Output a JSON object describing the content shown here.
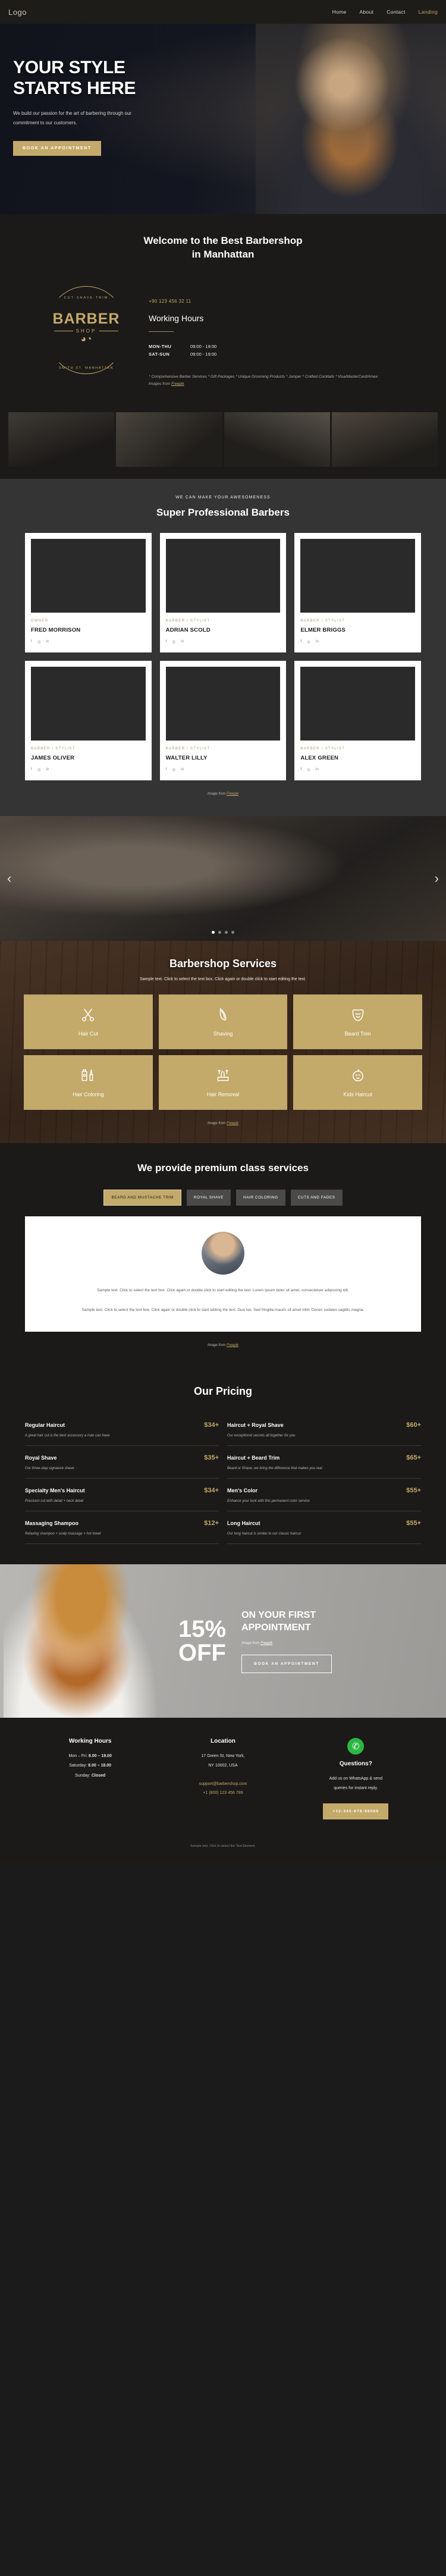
{
  "nav": {
    "logo": "Logo",
    "links": [
      {
        "label": "Home",
        "active": false
      },
      {
        "label": "About",
        "active": false
      },
      {
        "label": "Contact",
        "active": false
      },
      {
        "label": "Landing",
        "active": true
      }
    ]
  },
  "hero": {
    "title_line1": "YOUR STYLE",
    "title_line2": "STARTS HERE",
    "paragraph": "We build our passion for the art of barbering through our commitment to our customers.",
    "cta": "BOOK AN APPOINTMENT"
  },
  "welcome": {
    "heading_line1": "Welcome to the Best Barbershop",
    "heading_line2": "in Manhattan",
    "badge": {
      "arc_top": "CUT·SHAVE·TRIM",
      "word": "BARBER",
      "shop": "SHOP",
      "arc_bottom": "SMITH ST. MANHATTAN"
    },
    "phone": "+90 123 456 32 11",
    "hours_title": "Working Hours",
    "hours": [
      {
        "day": "MON-THU",
        "time": "09:00 - 19:00"
      },
      {
        "day": "SAT-SUN",
        "time": "09:00 - 19:00"
      }
    ],
    "fine_print": "* Comprehensive Barber Services * Gift Packages * Unique Grooming Products * Juniper * Crafted Cocktails *  Visa/MasterCard/Amex. Images from ",
    "fine_print_link": "Freepik"
  },
  "barbers": {
    "eyebrow": "WE CAN MAKE YOUR AWESOMENESS",
    "heading": "Super Professional Barbers",
    "people": [
      {
        "role": "OWNER",
        "name": "FRED MORRISON"
      },
      {
        "role": "BARBER / STYLIST",
        "name": "ADRIAN SCOLD"
      },
      {
        "role": "BARBER / STYLIST",
        "name": "ELMER BRIGGS"
      },
      {
        "role": "BARBER / STYLIST",
        "name": "JAMES OLIVER"
      },
      {
        "role": "BARBER / STYLIST",
        "name": "WALTER LILLY"
      },
      {
        "role": "BARBER / STYLIST",
        "name": "ALEX GREEN"
      }
    ],
    "socials": [
      "f",
      "◎",
      "in"
    ],
    "credit_prefix": "Image from ",
    "credit_link": "Freepik"
  },
  "slider": {
    "prev": "‹",
    "next": "›",
    "dots": 4,
    "active_dot": 0
  },
  "services": {
    "heading": "Barbershop Services",
    "subtitle": "Sample text. Click to select the text box. Click again or double click to start editing the text.",
    "items": [
      {
        "label": "Hair Cut",
        "icon": "scissors-icon"
      },
      {
        "label": "Shaving",
        "icon": "razor-icon"
      },
      {
        "label": "Beard Trim",
        "icon": "beard-icon"
      },
      {
        "label": "Hair Coloring",
        "icon": "hair-color-icon"
      },
      {
        "label": "Hair Removal",
        "icon": "hair-removal-icon"
      },
      {
        "label": "Kids Haircut",
        "icon": "kid-face-icon"
      }
    ],
    "credit_prefix": "Image from ",
    "credit_link": "Freepik"
  },
  "premium": {
    "heading": "We provide premium class services",
    "tabs": [
      {
        "label": "BEARD AND MUSTACHE TRIM",
        "active": true
      },
      {
        "label": "ROYAL SHAVE",
        "active": false
      },
      {
        "label": "HAIR COLORING",
        "active": false
      },
      {
        "label": "CUTS AND FADES",
        "active": false
      }
    ],
    "body_line1": "Sample text. Click to select the text box. Click again or double click to start editing the text. Lorem ipsum dolor sit amet, consectetuer adipiscing elit.",
    "body_line2": "Sample text. Click to select the text box. Click again or double click to start editing the text. Duis leo. Sed fringilla mauris sit amet nibh. Donec sodales sagittis magna.",
    "credit_prefix": "Image from ",
    "credit_link": "Freepik"
  },
  "pricing": {
    "heading": "Our Pricing",
    "items": [
      {
        "name": "Regular Haircut",
        "price": "$34+",
        "desc": "A great hair cut is the best accessory a man can have"
      },
      {
        "name": "Haircut + Royal Shave",
        "price": "$60+",
        "desc": "Our exceptional secrets all together for you"
      },
      {
        "name": "Royal Shave",
        "price": "$35+",
        "desc": "Our three-step signature shave"
      },
      {
        "name": "Haircut + Beard Trim",
        "price": "$65+",
        "desc": "Beard or Shave, we bring the difference that makes you real"
      },
      {
        "name": "Specialty Men's Haircut",
        "price": "$34+",
        "desc": "Precision cut with detail + neck detail"
      },
      {
        "name": "Men's Color",
        "price": "$55+",
        "desc": "Enhance your look with this permanent color service"
      },
      {
        "name": "Massaging Shampoo",
        "price": "$12+",
        "desc": "Relaxing shampoo + scalp massage + hot towel"
      },
      {
        "name": "Long Haircut",
        "price": "$55+",
        "desc": "Our long haircut is similar to our classic haircut"
      }
    ]
  },
  "promo": {
    "percent": "15%",
    "off": "OFF",
    "headline_line1": "ON YOUR FIRST",
    "headline_line2": "APPOINTMENT",
    "credit_prefix": "Image from ",
    "credit_link": "Freepik",
    "cta": "BOOK AN APPOINTMENT"
  },
  "footer": {
    "hours": {
      "title": "Working Hours",
      "rows": [
        {
          "label": "Mon – Fri: ",
          "value": "8.00 – 19.00"
        },
        {
          "label": "Saturday: ",
          "value": "8.00 – 18.00"
        },
        {
          "label": "Sunday: ",
          "value": "Closed"
        }
      ]
    },
    "location": {
      "title": "Location",
      "address_line1": "17 Green St, New York,",
      "address_line2": "NY 10002, USA",
      "email": "support@barbershop.com",
      "phone": "+1 (800) 123 456 789"
    },
    "questions": {
      "icon": "whatsapp-icon",
      "title": "Questions?",
      "body_line1": "Add us on WhatsApp & send",
      "body_line2": "queries for instant reply.",
      "cta": "+12-345-678-89089"
    },
    "bottom_prefix": "Sample text. Click to select the Text Element.",
    "bottom_link": ""
  },
  "colors": {
    "gold": "#c3a96a",
    "dark": "#1b1a18",
    "panel_gray": "#343434",
    "whatsapp_green": "#2cb742"
  }
}
